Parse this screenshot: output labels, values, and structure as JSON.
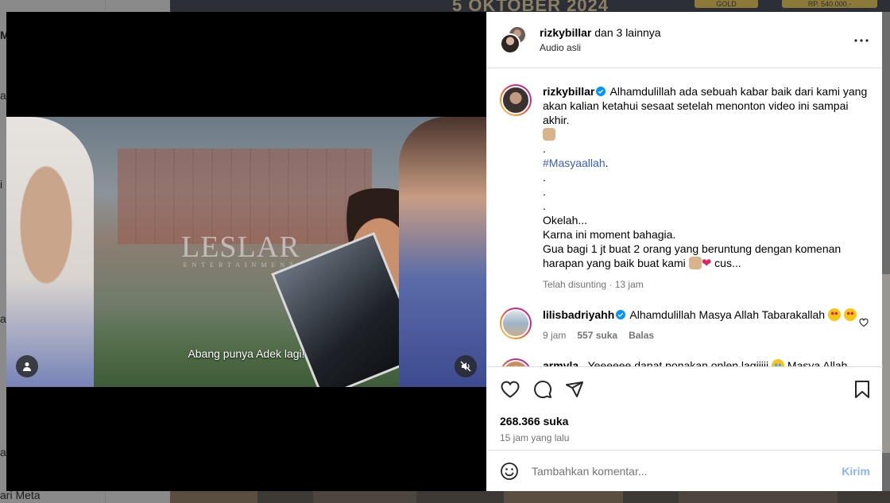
{
  "background": {
    "left_letters": [
      "M",
      "a",
      "i",
      "a",
      "a"
    ],
    "left_bottom_text": "ari Meta",
    "top_banner_date": "5 OKTOBER 2024",
    "top_badge_gold": "GOLD",
    "top_badge_price": "RP. 540.000,-"
  },
  "video": {
    "watermark": "LESLAR",
    "watermark_sub": "ENTERTAINMENT",
    "subtitle": "Abang punya Adek lagi!"
  },
  "header": {
    "owner": "rizkybillar",
    "collab_suffix": " dan 3 lainnya",
    "audio": "Audio asli"
  },
  "caption": {
    "username": "rizkybillar",
    "line1": " Alhamdulillah ada sebuah kabar baik dari kami yang akan kalian ketahui sesaat setelah menonton video ini sampai akhir.",
    "dot1": ".",
    "hashtag": "#Masyaallah",
    "hashtag_tail": ".",
    "dot2": ".",
    "dot3": ".",
    "dot4": ".",
    "line_okelah": "Okelah...",
    "line_karna": "Karna ini moment bahagia.",
    "line_gua": "Gua bagi 1 jt buat 2 orang yang beruntung dengan komenan harapan yang baik buat kami",
    "line_tail": " cus...",
    "meta": "Telah disunting · 13 jam"
  },
  "comments": [
    {
      "username": "lilisbadriyahh",
      "text": " Alhamdulillah Masya Allah Tabarakallah",
      "time": "9 jam",
      "likes": "557 suka",
      "reply": "Balas"
    },
    {
      "username": "armyla_",
      "text": " Yeeeeee dapat ponakan onlen lagiiiii",
      "text_tail": " Masya Allah"
    }
  ],
  "actions": {
    "likes": "268.366 suka",
    "time_ago": "15 jam yang lalu"
  },
  "composer": {
    "placeholder": "Tambahkan komentar...",
    "send": "Kirim"
  },
  "icons": [
    "verified-badge-icon",
    "heart-icon",
    "comment-icon",
    "share-icon",
    "bookmark-icon",
    "emoji-icon",
    "more-icon",
    "user-icon",
    "mute-icon"
  ],
  "colors": {
    "link": "#00376b",
    "hashtag": "#3a5cc5",
    "verified": "#0095f6",
    "send_disabled": "#8ab6e8"
  }
}
